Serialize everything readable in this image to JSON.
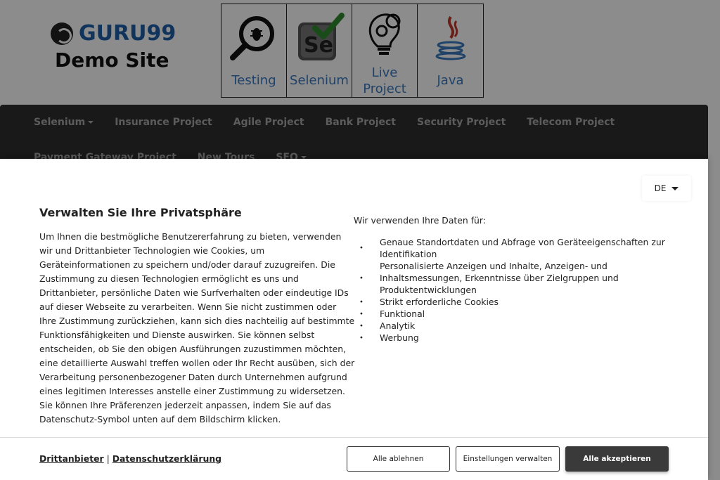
{
  "site": {
    "logo": {
      "brand": "GURU99",
      "subtitle": "Demo Site"
    },
    "tiles": [
      {
        "label": "Testing",
        "icon": "magnifier-bug-icon"
      },
      {
        "label": "Selenium",
        "icon": "selenium-logo-icon"
      },
      {
        "label": "Live Project",
        "icon": "lightbulb-gears-icon"
      },
      {
        "label": "Java",
        "icon": "java-cup-icon"
      }
    ],
    "nav": {
      "row1": [
        {
          "label": "Selenium",
          "dropdown": true
        },
        {
          "label": "Insurance Project",
          "dropdown": false
        },
        {
          "label": "Agile Project",
          "dropdown": false
        },
        {
          "label": "Bank Project",
          "dropdown": false
        },
        {
          "label": "Security Project",
          "dropdown": false
        },
        {
          "label": "Telecom Project",
          "dropdown": false
        }
      ],
      "row2": [
        {
          "label": "Payment Gateway Project",
          "dropdown": false
        },
        {
          "label": "New Tours",
          "dropdown": false
        },
        {
          "label": "SEO",
          "dropdown": true
        }
      ]
    }
  },
  "consent": {
    "language": "DE",
    "title": "Verwalten Sie Ihre Privatsphäre",
    "body": "Um Ihnen die bestmögliche Benutzererfahrung zu bieten, verwenden wir und Drittanbieter Technologien wie Cookies, um Geräteinformationen zu speichern und/oder darauf zuzugreifen. Die Zustimmung zu diesen Technologien ermöglicht es uns und Drittanbieter, persönliche Daten wie Surfverhalten oder eindeutige IDs auf dieser Webseite zu verarbeiten. Wenn Sie nicht zustimmen oder Ihre Zustimmung zurückziehen, kann sich dies nachteilig auf bestimmte Funktionsfähigkeiten und Dienste auswirken. Sie können selbst entscheiden, ob Sie den obigen Ausführungen zuzustimmen möchten, eine detaillierte Auswahl treffen wollen oder Ihr Recht ausüben, sich der Verarbeitung personenbezogener Daten durch Unternehmen aufgrund eines legitimen Interesses anstelle einer Zustimmung zu widersetzen. Sie können Ihre Präferenzen jederzeit anpassen, indem Sie auf das Datenschutz-Symbol unten auf dem Bildschirm klicken.",
    "purposes_heading": "Wir verwenden Ihre Daten für:",
    "purposes": [
      "Genaue Standortdaten und Abfrage von Geräteeigenschaften zur Identifikation",
      "Personalisierte Anzeigen und Inhalte, Anzeigen- und Inhaltsmessungen, Erkenntnisse über Zielgruppen und Produktentwicklungen",
      "Strikt erforderliche Cookies",
      "Funktional",
      "Analytik",
      "Werbung"
    ],
    "links": {
      "third_parties": "Drittanbieter",
      "separator": "|",
      "privacy_policy": "Datenschutzerklärung"
    },
    "buttons": {
      "reject": "Alle ablehnen",
      "manage": "Einstellungen verwalten",
      "accept": "Alle akzeptieren"
    },
    "colors": {
      "accept_bg": "#3a3a3a",
      "brand_blue": "#1f5fa8",
      "tile_label": "#3a78c0",
      "nav_bg": "#2f2f2f"
    }
  }
}
